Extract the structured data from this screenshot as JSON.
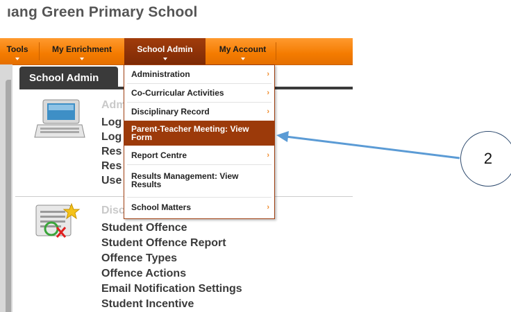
{
  "school_title": "ıang Green Primary School",
  "nav": {
    "tools": "Tools",
    "enrichment": "My Enrichment",
    "school_admin": "School Admin",
    "account": "My Account"
  },
  "panel_title": "School Admin",
  "section1": {
    "title": "Adm",
    "links": [
      "Log",
      "Log",
      "Res",
      "Res",
      "Use"
    ]
  },
  "section2": {
    "title": "Disc",
    "links": [
      "Student Offence",
      "Student Offence Report",
      "Offence Types",
      "Offence Actions",
      "Email Notification Settings",
      "Student Incentive"
    ]
  },
  "dropdown": {
    "items": [
      {
        "label": "Administration",
        "submenu": true
      },
      {
        "label": "Co-Curricular Activities",
        "submenu": true
      },
      {
        "label": "Disciplinary Record",
        "submenu": true
      },
      {
        "label": "Parent-Teacher Meeting: View Form",
        "submenu": false,
        "highlighted": true
      },
      {
        "label": "Report Centre",
        "submenu": true
      },
      {
        "label": "Results Management: View Results",
        "submenu": false
      },
      {
        "label": "School Matters",
        "submenu": true
      }
    ],
    "arrow": "›"
  },
  "annotation": {
    "number": "2",
    "arrow_color": "#5b9bd5",
    "circle_border": "#2d4a6e"
  },
  "colors": {
    "nav_orange": "#f47b00",
    "nav_active": "#8a300a",
    "highlight": "#9c3a0a"
  }
}
